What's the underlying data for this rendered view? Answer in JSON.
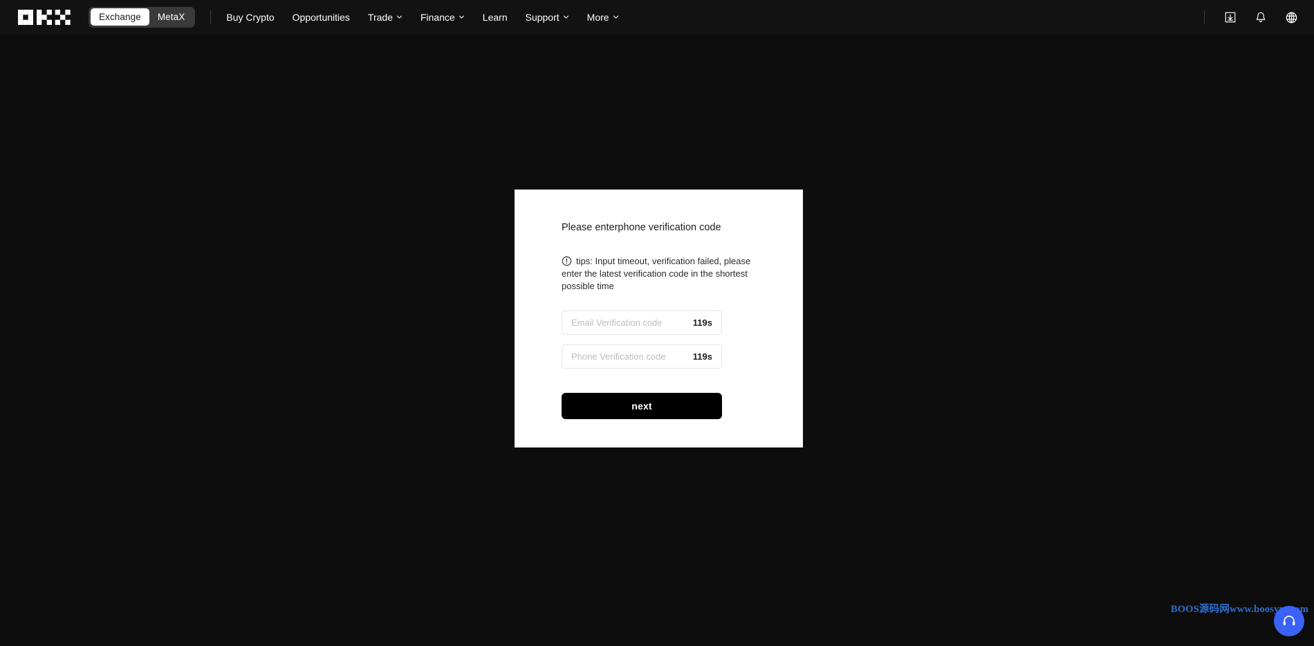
{
  "nav": {
    "logo_name": "okx-logo",
    "toggle": {
      "options": [
        {
          "label": "Exchange",
          "active": true
        },
        {
          "label": "MetaX",
          "active": false
        }
      ]
    },
    "links": [
      {
        "label": "Buy Crypto",
        "caret": false
      },
      {
        "label": "Opportunities",
        "caret": false
      },
      {
        "label": "Trade",
        "caret": true
      },
      {
        "label": "Finance",
        "caret": true
      },
      {
        "label": "Learn",
        "caret": false
      },
      {
        "label": "Support",
        "caret": true
      },
      {
        "label": "More",
        "caret": true
      }
    ],
    "right_icons": [
      {
        "name": "download-icon"
      },
      {
        "name": "bell-icon"
      },
      {
        "name": "globe-icon"
      }
    ]
  },
  "card": {
    "title": "Please enterphone verification code",
    "tips_icon": "exclamation-circle-icon",
    "tips_text": "tips: Input timeout, verification failed, please enter the latest verification code in the shortest possible time",
    "fields": [
      {
        "name": "email-verification-code",
        "placeholder": "Email Verification code",
        "value": "",
        "countdown": "119s"
      },
      {
        "name": "phone-verification-code",
        "placeholder": "Phone Verification code",
        "value": "",
        "countdown": "119s"
      }
    ],
    "submit_label": "next"
  },
  "watermark": {
    "text": "BOOS源码网www.boosym.com"
  },
  "support": {
    "icon": "headset-icon",
    "color": "#3b62f6"
  },
  "colors": {
    "page_background": "#0d0d0d",
    "navbar_background": "#121212",
    "card_background": "#ffffff",
    "button_background": "#000000",
    "accent": "#3b62f6",
    "watermark": "#2f6fd0"
  }
}
